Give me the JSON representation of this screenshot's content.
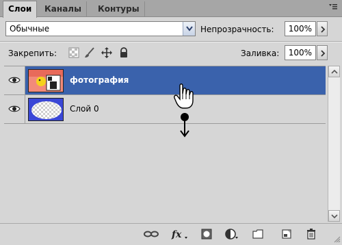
{
  "tabs": [
    {
      "label": "Слои",
      "active": true
    },
    {
      "label": "Каналы",
      "active": false
    },
    {
      "label": "Контуры",
      "active": false
    }
  ],
  "panel_menu_icon": "panel-menu-icon",
  "blend_mode": {
    "value": "Обычные"
  },
  "opacity": {
    "label": "Непрозрачность:",
    "value": "100%"
  },
  "lock": {
    "label": "Закрепить:",
    "icons": [
      "lock-transparency-icon",
      "lock-paint-icon",
      "lock-move-icon",
      "lock-all-icon"
    ]
  },
  "fill": {
    "label": "Заливка:",
    "value": "100%"
  },
  "layers": [
    {
      "name": "фотография",
      "selected": true,
      "visible": true,
      "thumb": "photo-thumbnail"
    },
    {
      "name": "Слой 0",
      "selected": false,
      "visible": true,
      "thumb": "ellipse-thumbnail"
    }
  ],
  "toolbar_icons": [
    "link-layers-icon",
    "fx-icon",
    "add-mask-icon",
    "adjustment-layer-icon",
    "new-group-icon",
    "new-layer-icon",
    "delete-layer-icon"
  ],
  "colors": {
    "selection": "#3a62ac",
    "panel_bg": "#d6d6d6"
  }
}
